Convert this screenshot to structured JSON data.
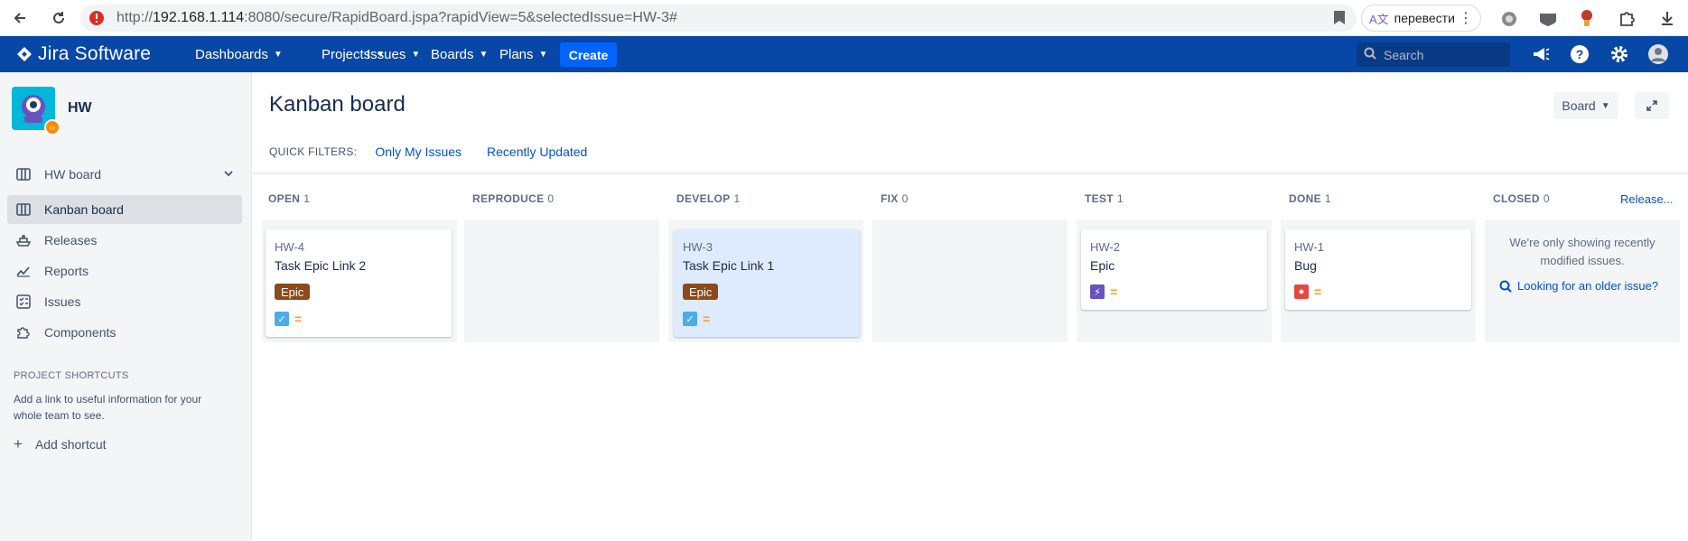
{
  "browser": {
    "url_prefix": "http://",
    "url_host": "192.168.1.114",
    "url_rest": ":8080/secure/RapidBoard.jspa?rapidView=5&selectedIssue=HW-3#",
    "translate_label": "перевести"
  },
  "topnav": {
    "logo": "Jira Software",
    "items": [
      "Dashboards",
      "Projects",
      "Issues",
      "Boards",
      "Plans"
    ],
    "create_label": "Create",
    "search_placeholder": "Search"
  },
  "sidebar": {
    "project_name": "HW",
    "board_selector": "HW board",
    "items": [
      {
        "label": "Kanban board",
        "icon": "board-icon",
        "active": true
      },
      {
        "label": "Releases",
        "icon": "ship-icon"
      },
      {
        "label": "Reports",
        "icon": "chart-icon"
      },
      {
        "label": "Issues",
        "icon": "issues-icon"
      },
      {
        "label": "Components",
        "icon": "puzzle-icon"
      }
    ],
    "shortcuts_heading": "PROJECT SHORTCUTS",
    "shortcuts_text": "Add a link to useful information for your whole team to see.",
    "add_shortcut": "Add shortcut"
  },
  "main": {
    "title": "Kanban board",
    "board_button": "Board",
    "quick_filters_label": "QUICK FILTERS:",
    "quick_filters": [
      "Only My Issues",
      "Recently Updated"
    ],
    "release_link": "Release...",
    "columns": [
      {
        "name": "OPEN",
        "count": "1"
      },
      {
        "name": "REPRODUCE",
        "count": "0"
      },
      {
        "name": "DEVELOP",
        "count": "1"
      },
      {
        "name": "FIX",
        "count": "0"
      },
      {
        "name": "TEST",
        "count": "1"
      },
      {
        "name": "DONE",
        "count": "1"
      },
      {
        "name": "CLOSED",
        "count": "0"
      }
    ],
    "cards": [
      {
        "key": "HW-4",
        "summary": "Task Epic Link 2",
        "epic": "Epic",
        "type": "task"
      },
      {
        "key": "HW-3",
        "summary": "Task Epic Link 1",
        "epic": "Epic",
        "type": "task",
        "selected": true
      },
      {
        "key": "HW-2",
        "summary": "Epic",
        "type": "epic"
      },
      {
        "key": "HW-1",
        "summary": "Bug",
        "type": "bug"
      }
    ],
    "closed_message": "We're only showing recently modified issues.",
    "older_issue_link": "Looking for an older issue?"
  },
  "colors": {
    "topnav": "#0747a6",
    "create": "#0065ff",
    "epic_label": "#8b4a1c",
    "selected_card": "#deebff",
    "link": "#0052cc"
  }
}
